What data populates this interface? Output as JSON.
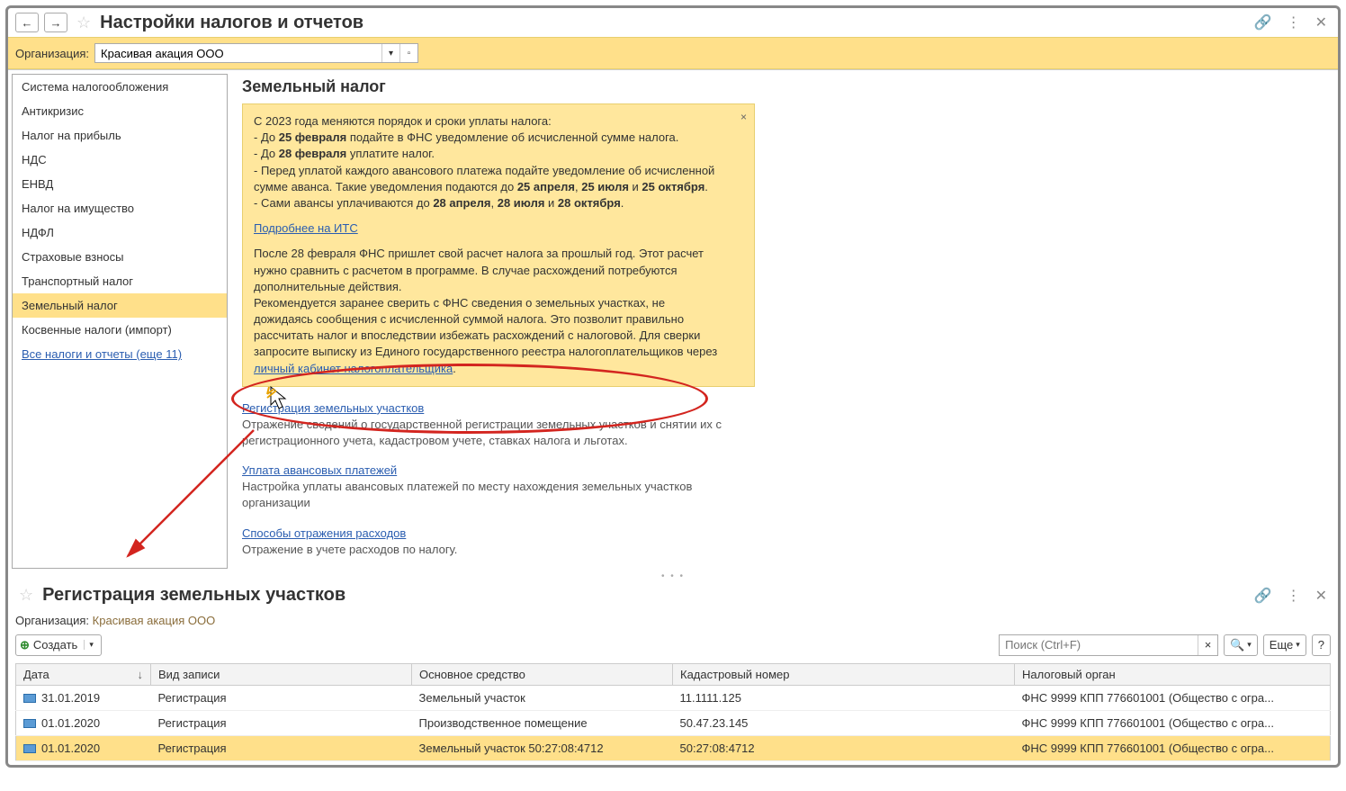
{
  "top": {
    "title": "Настройки налогов и отчетов",
    "org_label": "Организация:",
    "org_value": "Красивая акация ООО",
    "sidebar": {
      "items": [
        "Система налогообложения",
        "Антикризис",
        "Налог на прибыль",
        "НДС",
        "ЕНВД",
        "Налог на имущество",
        "НДФЛ",
        "Страховые взносы",
        "Транспортный налог",
        "Земельный налог",
        "Косвенные налоги (импорт)"
      ],
      "more_link": "Все налоги и отчеты (еще 11)"
    },
    "content": {
      "heading": "Земельный налог",
      "notice": {
        "line1": "С 2023 года меняются порядок и сроки уплаты налога:",
        "line2_a": " - До ",
        "line2_b": "25 февраля",
        "line2_c": " подайте в ФНС уведомление об исчисленной сумме налога.",
        "line3_a": " - До ",
        "line3_b": "28 февраля",
        "line3_c": " уплатите налог.",
        "line4_a": " - Перед уплатой каждого авансового платежа подайте уведомление об исчисленной сумме аванса. Такие уведомления подаются до ",
        "line4_b": "25 апреля",
        "line4_c": ", ",
        "line4_d": "25 июля",
        "line4_e": " и ",
        "line4_f": "25 октября",
        "line4_g": ".",
        "line5_a": " - Сами авансы уплачиваются до ",
        "line5_b": "28 апреля",
        "line5_c": ", ",
        "line5_d": "28 июля",
        "line5_e": " и ",
        "line5_f": "28 октября",
        "line5_g": ".",
        "more_link": "Подробнее на ИТС",
        "para2": "После 28 февраля ФНС пришлет свой расчет налога за прошлый год. Этот расчет нужно сравнить с расчетом в программе. В случае расхождений потребуются дополнительные действия.",
        "para3_a": "Рекомендуется заранее сверить с ФНС сведения о земельных участках, не дожидаясь сообщения с исчисленной суммой налога. Это позволит правильно рассчитать налог и впоследствии избежать расхождений с налоговой. Для сверки запросите выписку из Единого государственного реестра налогоплательщиков через ",
        "para3_link": "личный кабинет налогоплательщика",
        "para3_b": "."
      },
      "links": {
        "reg_title": "Регистрация земельных участков",
        "reg_desc": "Отражение сведений о государственной регистрации земельных участков и снятии их с регистрационного учета, кадастровом учете, ставках налога и льготах.",
        "adv_title": "Уплата авансовых платежей",
        "adv_desc": "Настройка уплаты авансовых платежей по месту нахождения земельных участков организации",
        "exp_title": "Способы отражения расходов",
        "exp_desc": "Отражение в учете расходов по налогу."
      }
    }
  },
  "bottom": {
    "title": "Регистрация земельных участков",
    "org_label": "Организация:",
    "org_value": "Красивая акация ООО",
    "create_label": "Создать",
    "search_placeholder": "Поиск (Ctrl+F)",
    "more_label": "Еще",
    "columns": {
      "date": "Дата",
      "type": "Вид записи",
      "asset": "Основное средство",
      "cadastral": "Кадастровый номер",
      "tax_office": "Налоговый орган"
    },
    "rows": [
      {
        "date": "31.01.2019",
        "type": "Регистрация",
        "asset": "Земельный участок",
        "cadastral": "11.1111.125",
        "tax_office": "ФНС 9999 КПП 776601001 (Общество с огра..."
      },
      {
        "date": "01.01.2020",
        "type": "Регистрация",
        "asset": "Производственное помещение",
        "cadastral": "50.47.23.145",
        "tax_office": "ФНС 9999 КПП 776601001 (Общество с огра..."
      },
      {
        "date": "01.01.2020",
        "type": "Регистрация",
        "asset": "Земельный участок  50:27:08:4712",
        "cadastral": "50:27:08:4712",
        "tax_office": "ФНС 9999 КПП 776601001 (Общество с огра..."
      }
    ]
  }
}
